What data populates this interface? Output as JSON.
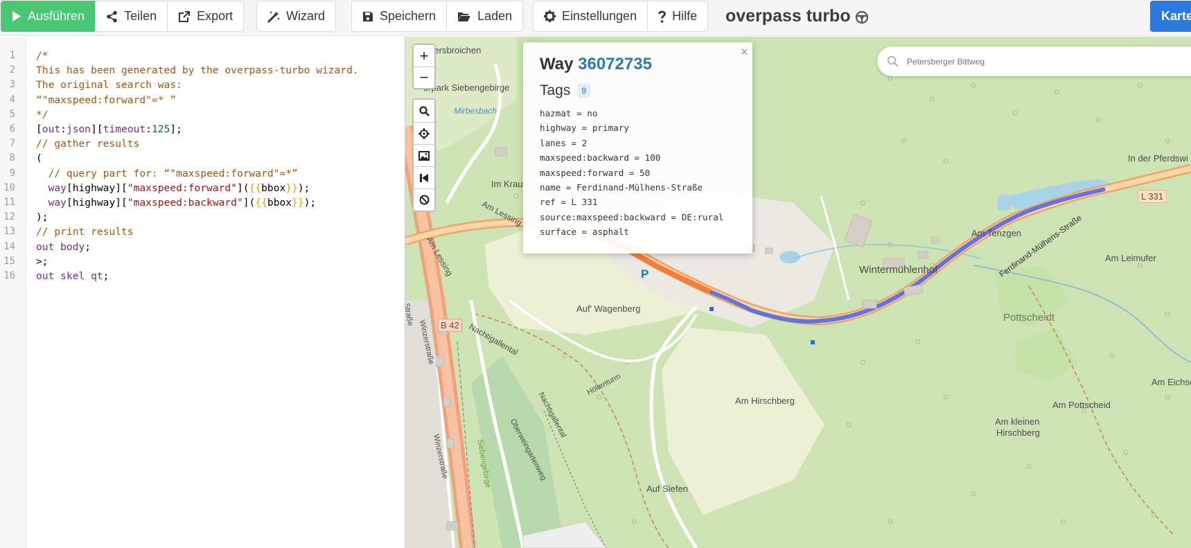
{
  "toolbar": {
    "run_label": "Ausführen",
    "share_label": "Teilen",
    "export_label": "Export",
    "wizard_label": "Wizard",
    "save_label": "Speichern",
    "load_label": "Laden",
    "settings_label": "Einstellungen",
    "help_label": "Hilfe",
    "app_title": "overpass turbo",
    "map_button_label": "Karte"
  },
  "editor": {
    "line_numbers": [
      "1",
      "2",
      "3",
      "4",
      "5",
      "6",
      "7",
      "8",
      "9",
      "10",
      "11",
      "12",
      "13",
      "14",
      "15",
      "16"
    ],
    "lines": [
      [
        {
          "t": "/*",
          "c": "c-com"
        }
      ],
      [
        {
          "t": "This has been generated by the overpass-turbo wizard.",
          "c": "c-com"
        }
      ],
      [
        {
          "t": "The original search was:",
          "c": "c-com"
        }
      ],
      [
        {
          "t": "“\"maxspeed:forward\"=* ”",
          "c": "c-com"
        }
      ],
      [
        {
          "t": "*/",
          "c": "c-com"
        }
      ],
      [
        {
          "t": "[",
          "c": ""
        },
        {
          "t": "out",
          "c": "c-kw"
        },
        {
          "t": ":",
          "c": ""
        },
        {
          "t": "json",
          "c": "c-kw"
        },
        {
          "t": "][",
          "c": ""
        },
        {
          "t": "timeout",
          "c": "c-kw"
        },
        {
          "t": ":",
          "c": ""
        },
        {
          "t": "125",
          "c": "c-num"
        },
        {
          "t": "];",
          "c": ""
        }
      ],
      [
        {
          "t": "// gather results",
          "c": "c-com"
        }
      ],
      [
        {
          "t": "(",
          "c": ""
        }
      ],
      [
        {
          "t": "  // query part for: “\"maxspeed:forward\"=*”",
          "c": "c-com"
        }
      ],
      [
        {
          "t": "  ",
          "c": ""
        },
        {
          "t": "way",
          "c": "c-kw"
        },
        {
          "t": "[highway][",
          "c": ""
        },
        {
          "t": "\"maxspeed:forward\"",
          "c": "c-str"
        },
        {
          "t": "](",
          "c": ""
        },
        {
          "t": "{{",
          "c": "c-tpl"
        },
        {
          "t": "bbox",
          "c": ""
        },
        {
          "t": "}}",
          "c": "c-tpl"
        },
        {
          "t": ");",
          "c": ""
        }
      ],
      [
        {
          "t": "  ",
          "c": ""
        },
        {
          "t": "way",
          "c": "c-kw"
        },
        {
          "t": "[highway][",
          "c": ""
        },
        {
          "t": "\"maxspeed:backward\"",
          "c": "c-str"
        },
        {
          "t": "](",
          "c": ""
        },
        {
          "t": "{{",
          "c": "c-tpl"
        },
        {
          "t": "bbox",
          "c": ""
        },
        {
          "t": "}}",
          "c": "c-tpl"
        },
        {
          "t": ");",
          "c": ""
        }
      ],
      [
        {
          "t": ");",
          "c": ""
        }
      ],
      [
        {
          "t": "// print results",
          "c": "c-com"
        }
      ],
      [
        {
          "t": "out body",
          "c": "c-kw"
        },
        {
          "t": ";",
          "c": ""
        }
      ],
      [
        {
          "t": ">;",
          "c": ""
        }
      ],
      [
        {
          "t": "out skel qt",
          "c": "c-kw"
        },
        {
          "t": ";",
          "c": ""
        }
      ]
    ]
  },
  "map": {
    "search_placeholder": "Petersberger Bittweg",
    "zoom_in": "+",
    "zoom_out": "−",
    "labels": {
      "wersbroichen": "wersbroichen",
      "kurpark": "urpark Siebengebirge",
      "mirbesbach": "Mirbesbach",
      "im_kraut": "Im Kraut",
      "am_lessing1": "Am Lessing",
      "am_lessing2": "Am Lessing",
      "auf_wagenberg": "Auf' Wagenberg",
      "b42": "B 42",
      "nachtigallental1": "Nachtigallental",
      "winzerstrasse1": "Winzerstraße",
      "winzerstrasse2": "Winzerstraße",
      "strasse": "Straße",
      "hollenturm": "Höllenturm",
      "nachtigallental2": "Nachtigallental",
      "oberweingartenweg": "Oberweingartenweg",
      "siebengebirge": "Siebengebirge",
      "am_hirschberg": "Am Hirschberg",
      "auf_siefen": "Auf Siefen",
      "wintermuehlenhof": "Wintermühlenhof",
      "am_tenzgen": "Am Tenzgen",
      "am_leimufer": "Am Leimufer",
      "pottscheidt": "Pottscheidt",
      "in_der_pferdswiese": "In der Pferdswi",
      "l331": "L 331",
      "ferdinand": "Ferdinand-Mülhens-Straße",
      "am_eichse": "Am Eichse",
      "am_pottscheid": "Am Pottscheid",
      "am_kleinen": "Am kleinen",
      "hirschberg": "Hirschberg",
      "parking": "P"
    }
  },
  "popup": {
    "close": "×",
    "type": "Way",
    "id": "36072735",
    "tags_label": "Tags",
    "tag_count": "9",
    "tags": [
      "hazmat = no",
      "highway = primary",
      "lanes = 2",
      "maxspeed:backward = 100",
      "maxspeed:forward = 50",
      "name = Ferdinand-Mülhens-Straße",
      "ref = L 331",
      "source:maxspeed:backward = DE:rural",
      "surface = asphalt"
    ]
  }
}
